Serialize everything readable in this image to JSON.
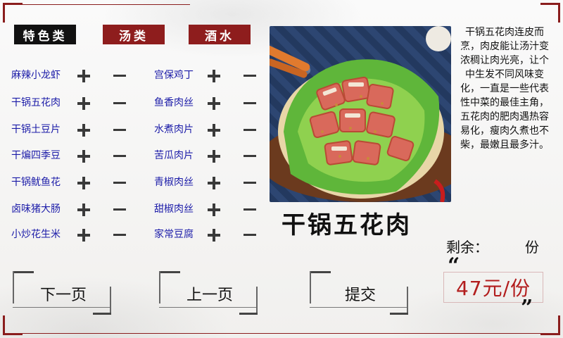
{
  "tabs": [
    {
      "label": "特色类",
      "active": true
    },
    {
      "label": "汤类",
      "active": false
    },
    {
      "label": "酒水",
      "active": false
    }
  ],
  "menu_left": [
    "麻辣小龙虾",
    "干锅五花肉",
    "干锅土豆片",
    "干煸四季豆",
    "干锅鱿鱼花",
    "卤味猪大肠",
    "小炒花生米"
  ],
  "menu_right": [
    "宫保鸡丁",
    "鱼香肉丝",
    "水煮肉片",
    "苦瓜肉片",
    "青椒肉丝",
    "甜椒肉丝",
    "家常豆腐"
  ],
  "selected_dish": {
    "title": "干锅五花肉",
    "description": "干锅五花肉连皮而烹，肉皮能让汤汁变浓稠让肉光亮，让个中生发不同风味变化，一直是一些代表性中菜的最佳主角，五花肉的肥肉遇热容易化，瘦肉久煮也不柴，最嫩且最多汁。",
    "remaining_label": "剩余：",
    "remaining_value": "",
    "remaining_unit": "份",
    "price": "47元/份"
  },
  "buttons": {
    "next_page": "下一页",
    "prev_page": "上一页",
    "submit": "提交"
  },
  "quotes": {
    "open": "“",
    "close": "”"
  },
  "colors": {
    "accent_red": "#8e1d1d",
    "item_blue": "#1a1aa6",
    "price_red": "#b21d1d"
  },
  "icons": {
    "plus": "plus-icon",
    "minus": "minus-icon"
  }
}
